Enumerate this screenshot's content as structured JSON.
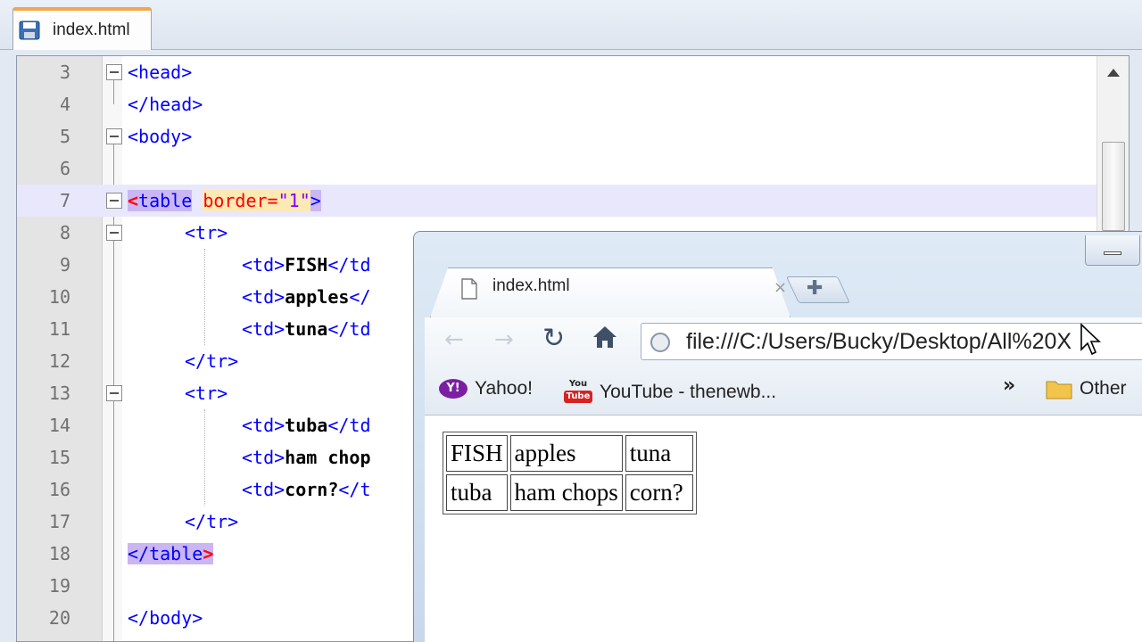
{
  "editor": {
    "tab_label": "index.html",
    "lines": [
      {
        "n": "3"
      },
      {
        "n": "4"
      },
      {
        "n": "5"
      },
      {
        "n": "6"
      },
      {
        "n": "7"
      },
      {
        "n": "8"
      },
      {
        "n": "9"
      },
      {
        "n": "10"
      },
      {
        "n": "11"
      },
      {
        "n": "12"
      },
      {
        "n": "13"
      },
      {
        "n": "14"
      },
      {
        "n": "15"
      },
      {
        "n": "16"
      },
      {
        "n": "17"
      },
      {
        "n": "18"
      },
      {
        "n": "19"
      },
      {
        "n": "20"
      }
    ],
    "code": {
      "l3": "<head>",
      "l4": "</head>",
      "l5": "<body>",
      "l7_brace_open": "<",
      "l7_tag": "table",
      "l7_attr": "border=",
      "l7_val": "\"1\"",
      "l7_brace_close": ">",
      "l8": "<tr>",
      "l9_open": "<td>",
      "l9_text": "FISH",
      "l9_close": "</td",
      "l10_open": "<td>",
      "l10_text": "apples",
      "l10_close": "</",
      "l11_open": "<td>",
      "l11_text": "tuna",
      "l11_close": "</td",
      "l12": "</tr>",
      "l13": "<tr>",
      "l14_open": "<td>",
      "l14_text": "tuba",
      "l14_close": "</td",
      "l15_open": "<td>",
      "l15_text": "ham chop",
      "l16_open": "<td>",
      "l16_text": "corn?",
      "l16_close": "</t",
      "l17": "</tr>",
      "l18_open": "</",
      "l18_tag": "table",
      "l18_close": ">",
      "l20": "</body>"
    }
  },
  "browser": {
    "tab_title": "index.html",
    "tab_close": "×",
    "new_tab_icon": "✚",
    "back_icon": "←",
    "forward_icon": "→",
    "reload_icon": "↻",
    "url": "file:///C:/Users/Bucky/Desktop/All%20X",
    "bookmarks": {
      "yahoo_icon": "Y!",
      "yahoo": "Yahoo!",
      "youtube_icon_top": "You",
      "youtube_icon_bottom": "Tube",
      "youtube": "YouTube - thenewb...",
      "more": "»",
      "other": "Other"
    },
    "table": {
      "rows": [
        [
          "FISH",
          "apples",
          "tuna"
        ],
        [
          "tuba",
          "ham chops",
          "corn?"
        ]
      ]
    }
  },
  "colors": {
    "tag": "#0000ff",
    "attribute": "#ff0000",
    "value": "#8000ff",
    "tag_highlight": "#c9b6f3",
    "attr_highlight": "#fde9b4",
    "tab_accent": "#f3a74a"
  }
}
